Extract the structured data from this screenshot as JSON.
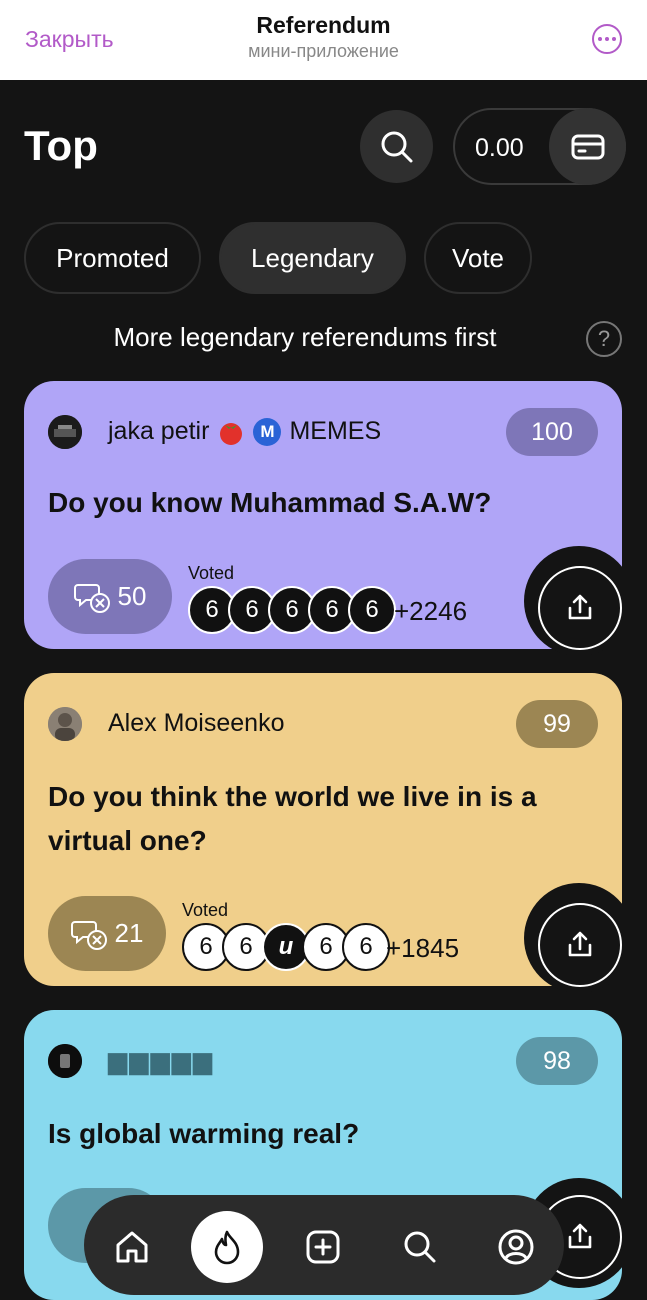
{
  "header": {
    "close_label": "Закрыть",
    "title": "Referendum",
    "subtitle": "мини-приложение",
    "more_icon": "more-icon"
  },
  "page": {
    "heading": "Top",
    "balance": "0.00"
  },
  "tabs": [
    {
      "label": "Promoted",
      "active": false
    },
    {
      "label": "Legendary",
      "active": true
    },
    {
      "label": "Vote",
      "active": false
    }
  ],
  "hint": "More legendary referendums first",
  "help_label": "?",
  "cards": [
    {
      "color": "#b0a5f7",
      "author": "jaka petir",
      "author_badges": [
        "tomato-emoji",
        "m-badge"
      ],
      "author_suffix": "MEMES",
      "m_badge_letter": "M",
      "score": "100",
      "question": "Do you know Muhammad S.A.W?",
      "comments": "50",
      "voted_label": "Voted",
      "voters": [
        "6",
        "6",
        "6",
        "6",
        "6"
      ],
      "voted_count": "+2246"
    },
    {
      "color": "#f0cf8b",
      "author": "Alex Moiseenko",
      "score": "99",
      "question": "Do you think the world we live in is a virtual one?",
      "comments": "21",
      "voted_label": "Voted",
      "voters": [
        "6",
        "6",
        "и",
        "6",
        "6"
      ],
      "voted_count": "+1845"
    },
    {
      "color": "#88d9ee",
      "author": "▆▆▆▆▆",
      "score": "98",
      "question": "Is global warming real?"
    }
  ],
  "nav": {
    "items": [
      "home-icon",
      "flame-icon",
      "add-icon",
      "search-icon",
      "profile-icon"
    ],
    "active": "flame-icon"
  }
}
